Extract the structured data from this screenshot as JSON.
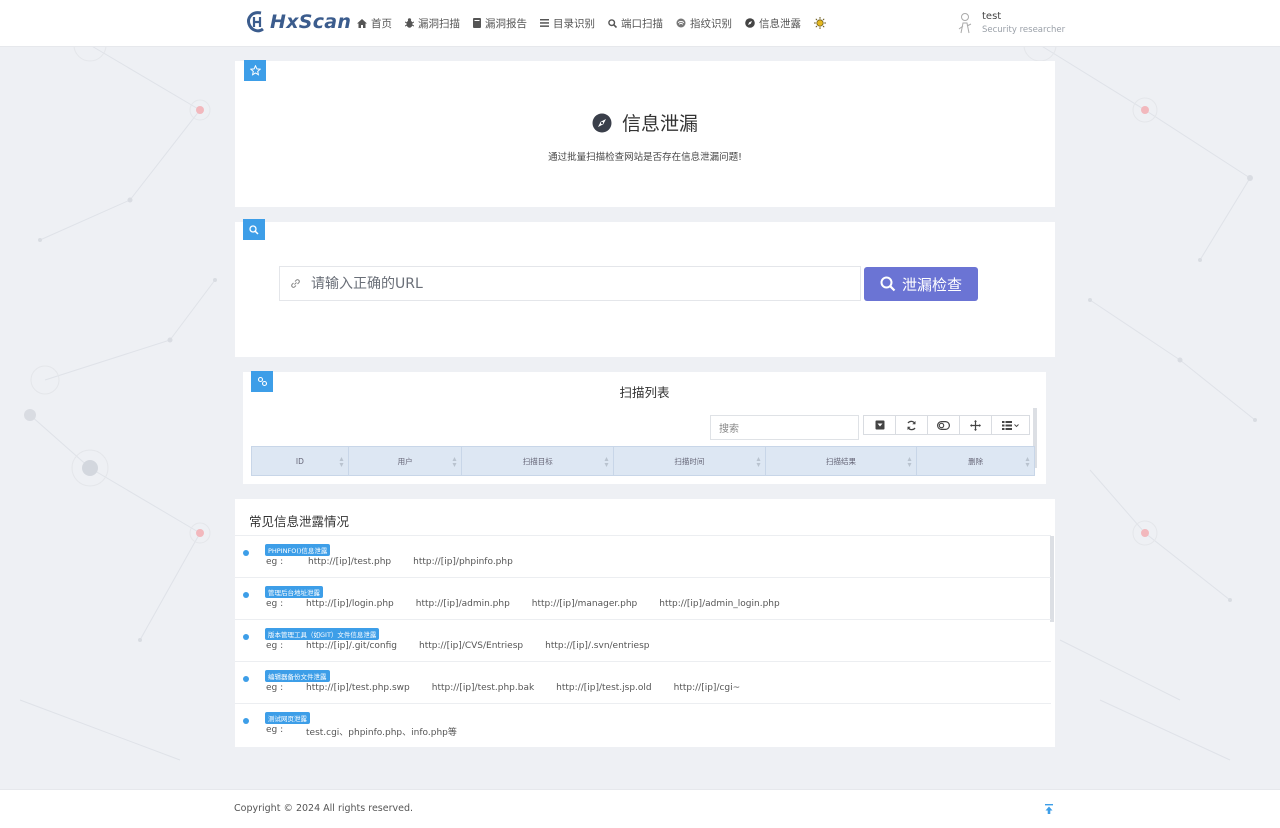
{
  "app": {
    "name": "HxScan",
    "accent": "#3d9ee8",
    "brand_color": "#3b5c8d",
    "button_color": "#6b74d4"
  },
  "nav": {
    "items": [
      {
        "label": "首页",
        "icon": "home-icon"
      },
      {
        "label": "漏洞扫描",
        "icon": "bug-icon"
      },
      {
        "label": "漏洞报告",
        "icon": "book-icon"
      },
      {
        "label": "目录识别",
        "icon": "list-icon"
      },
      {
        "label": "端口扫描",
        "icon": "search-icon"
      },
      {
        "label": "指纹识别",
        "icon": "fingerprint-icon"
      },
      {
        "label": "信息泄露",
        "icon": "compass-icon"
      }
    ],
    "theme_icon": "sun-icon"
  },
  "user": {
    "name": "test",
    "role": "Security researcher"
  },
  "hero": {
    "title": "信息泄漏",
    "subtitle": "通过批量扫描检查网站是否存在信息泄漏问题!",
    "badge_icon": "star-icon"
  },
  "scan_form": {
    "url_placeholder": "请输入正确的URL",
    "url_value": "",
    "button_label": "泄漏检查",
    "badge_icon": "search-icon"
  },
  "scan_list": {
    "title": "扫描列表",
    "search_placeholder": "搜索",
    "toolbar": [
      "export-icon",
      "refresh-icon",
      "toggle-icon",
      "fullscreen-icon",
      "columns-icon"
    ],
    "columns": [
      "ID",
      "用户",
      "扫描目标",
      "扫描时间",
      "扫描结果",
      "删除"
    ],
    "rows": []
  },
  "common_leaks": {
    "title": "常见信息泄露情况",
    "items": [
      {
        "tag": "PHPINFO()信息泄露",
        "eg_label": "eg :",
        "urls": [
          "http://[ip]/test.php",
          "http://[ip]/phpinfo.php"
        ]
      },
      {
        "tag": "管理后台地址泄露",
        "eg_label": "eg :",
        "urls": [
          "http://[ip]/login.php",
          "http://[ip]/admin.php",
          "http://[ip]/manager.php",
          "http://[ip]/admin_login.php"
        ]
      },
      {
        "tag": "版本管理工具（如GIT）文件信息泄露",
        "eg_label": "eg :",
        "urls": [
          "http://[ip]/.git/config",
          "http://[ip]/CVS/Entriesp",
          "http://[ip]/.svn/entriesp"
        ]
      },
      {
        "tag": "编辑器备份文件泄露",
        "eg_label": "eg :",
        "urls": [
          "http://[ip]/test.php.swp",
          "http://[ip]/test.php.bak",
          "http://[ip]/test.jsp.old",
          "http://[ip]/cgi~"
        ]
      },
      {
        "tag": "测试网页泄露",
        "eg_label": "eg :",
        "urls": [
          "test.cgi、phpinfo.php、info.php等"
        ]
      }
    ]
  },
  "footer": {
    "copyright": "Copyright © 2024 All rights reserved.",
    "to_top_icon": "arrow-up-icon"
  }
}
